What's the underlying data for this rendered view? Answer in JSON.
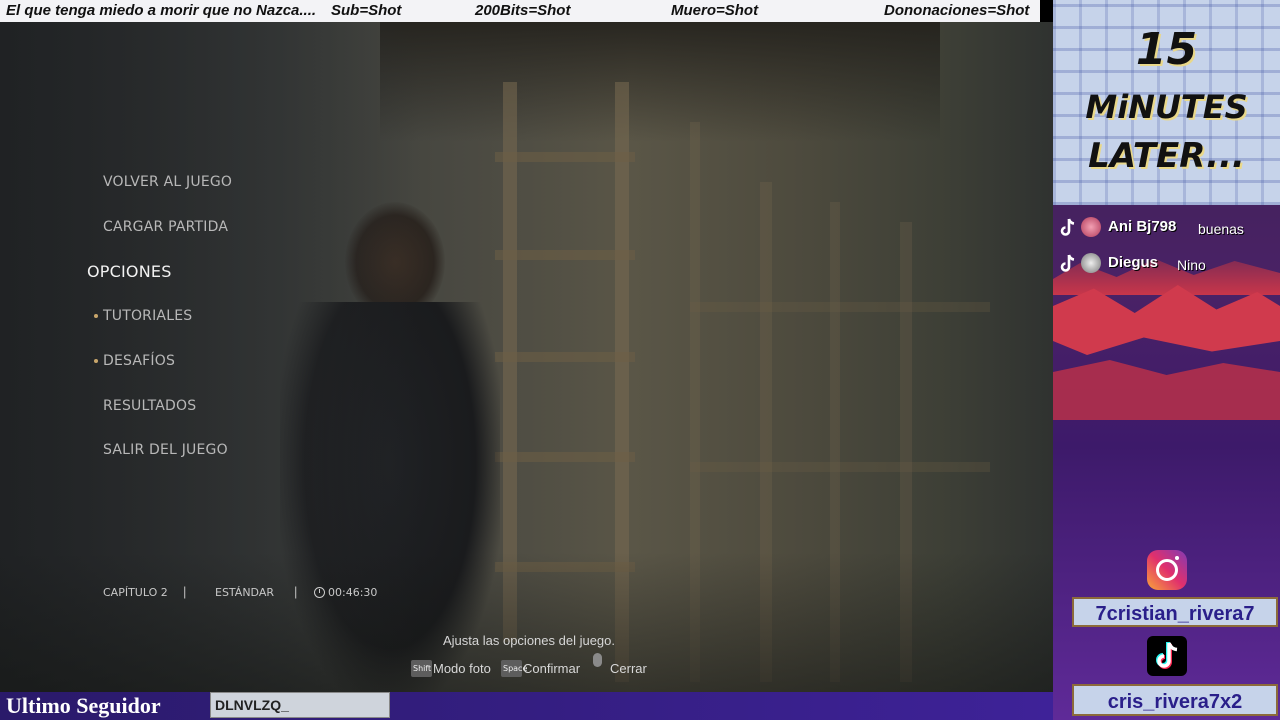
{
  "ticker": {
    "items": [
      "El que tenga miedo a morir que no Nazca....",
      "Sub=Shot",
      "200Bits=Shot",
      "Muero=Shot",
      "Dononaciones=Shot"
    ]
  },
  "game_menu": {
    "items": [
      {
        "label": "VOLVER AL JUEGO"
      },
      {
        "label": "CARGAR PARTIDA"
      },
      {
        "label": "OPCIONES",
        "active": true
      },
      {
        "label": "TUTORIALES",
        "sub": true
      },
      {
        "label": "DESAFÍOS",
        "sub": true
      },
      {
        "label": "RESULTADOS"
      },
      {
        "label": "SALIR DEL JUEGO"
      }
    ]
  },
  "status": {
    "chapter": "CAPÍTULO 2",
    "difficulty": "ESTÁNDAR",
    "separator": "|",
    "time": "00:46:30",
    "clock_icon": "clock-icon"
  },
  "hint": {
    "text": "Ajusta las opciones del juego.",
    "controls": [
      {
        "key": "Shift",
        "label": "Modo foto"
      },
      {
        "key": "Space",
        "label": "Confirmar"
      },
      {
        "key": "",
        "icon": "mouse-icon",
        "label": "Cerrar"
      }
    ]
  },
  "panel": {
    "banner": {
      "line1": "15",
      "line2": "MiNUTES",
      "line3": "LATER..."
    },
    "chat": [
      {
        "name": "Ani Bj798",
        "message": "buenas"
      },
      {
        "name": "Diegus",
        "message": "Nino"
      }
    ],
    "instagram_handle": "7cristian_rivera7",
    "tiktok_handle": "cris_rivera7x2",
    "colors": {
      "accent": "#3e2298",
      "handle_text": "#2a1f8a",
      "panel_bg": "#4a2266"
    }
  },
  "footer": {
    "follower_label": "Ultimo Seguidor",
    "follower_name": "DLNVLZQ_"
  }
}
